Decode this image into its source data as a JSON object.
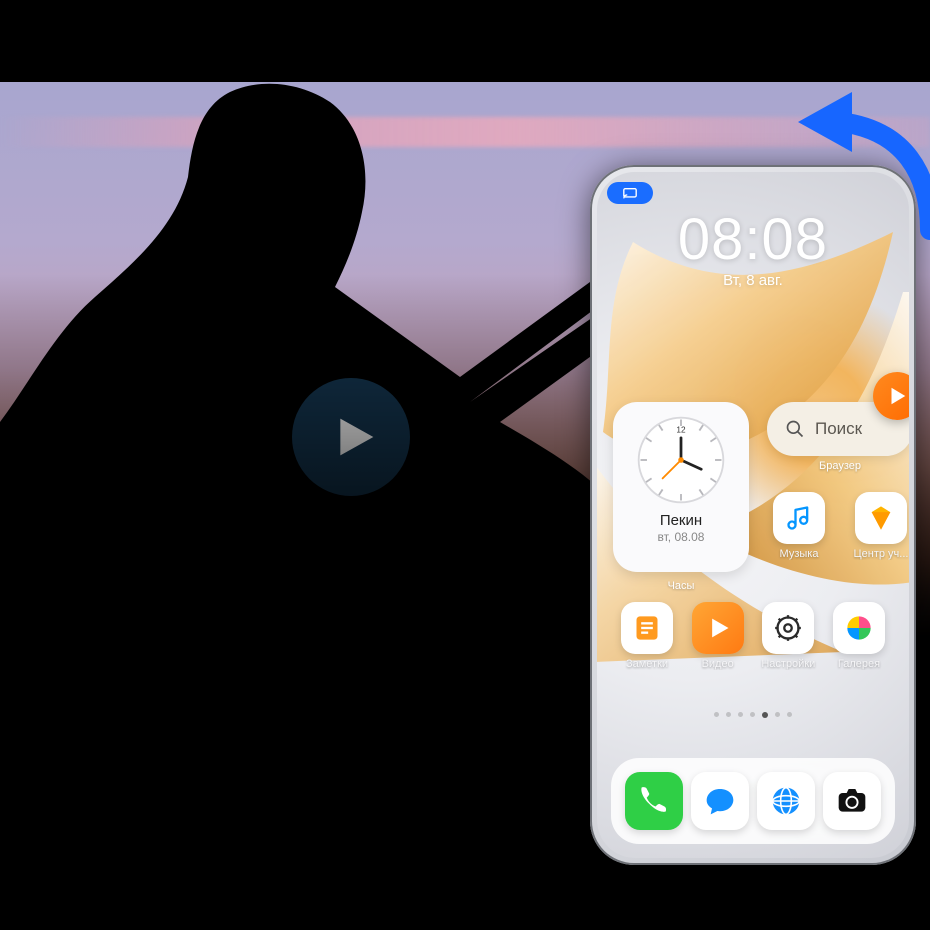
{
  "colors": {
    "accent_blue": "#1a6dff",
    "play_bg": "rgba(23,60,90,0.88)",
    "arrow": "#1766ff",
    "orange": "#ff7a12"
  },
  "video": {
    "play_label": "Воспроизвести"
  },
  "phone": {
    "status": {
      "cast_icon": "cast-icon"
    },
    "lock": {
      "time": "08:08",
      "date": "Вт, 8 авг."
    },
    "float": {
      "icon": "play-triangle-icon"
    },
    "widgets": {
      "clock": {
        "city": "Пекин",
        "sub": "вт, 08.08",
        "label": "Часы"
      },
      "search": {
        "placeholder": "Поиск",
        "label": "Браузер"
      },
      "music": {
        "label": "Музыка",
        "icon": "music-note-icon",
        "bg": "#ffffff",
        "fg": "#0596ff"
      },
      "member": {
        "label": "Центр уч...",
        "icon": "diamond-icon",
        "bg": "#ffffff",
        "fg": "#ffb400"
      }
    },
    "grid": [
      {
        "label": "Заметки",
        "icon": "notes-icon",
        "bg": "#ffffff",
        "fg": "#ff9a1f"
      },
      {
        "label": "Видео",
        "icon": "play-triangle-icon",
        "bg": "linear-gradient(135deg,#ffa635,#ff7a12)",
        "fg": "#ffffff"
      },
      {
        "label": "Настройки",
        "icon": "gear-icon",
        "bg": "#ffffff",
        "fg": "#2b2b2b"
      },
      {
        "label": "Галерея",
        "icon": "pinwheel-icon",
        "bg": "#ffffff",
        "fg": "multicolor"
      }
    ],
    "dock": [
      {
        "name": "phone-app",
        "icon": "phone-icon",
        "bg": "#2fcf46",
        "fg": "#ffffff"
      },
      {
        "name": "messages-app",
        "icon": "chat-icon",
        "bg": "#ffffff",
        "fg": "#1490ff"
      },
      {
        "name": "browser-app",
        "icon": "globe-icon",
        "bg": "#ffffff",
        "fg": "#1490ff"
      },
      {
        "name": "camera-app",
        "icon": "camera-icon",
        "bg": "#ffffff",
        "fg": "#111111"
      }
    ],
    "page_indicator": {
      "total": 7,
      "current": 5
    }
  }
}
